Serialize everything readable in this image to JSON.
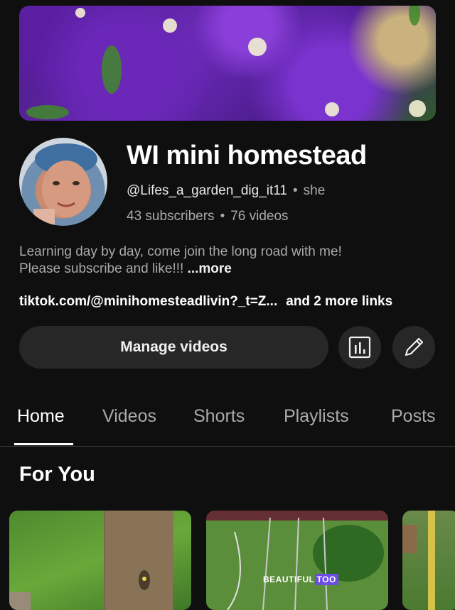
{
  "channel": {
    "title": "WI mini homestead",
    "handle": "@Lifes_a_garden_dig_it11",
    "pronoun": "she",
    "subscribers": "43 subscribers",
    "videos": "76 videos",
    "description_line1": "Learning day by day, come join the long road with me!",
    "description_line2": "Please subscribe and like!!!",
    "more_label": "...more",
    "link": "tiktok.com/@minihomesteadlivin?_t=Z...",
    "more_links": "and 2 more links"
  },
  "actions": {
    "manage_videos": "Manage videos",
    "analytics_icon": "analytics-icon",
    "edit_icon": "pencil-icon"
  },
  "tabs": [
    {
      "label": "Home",
      "active": true
    },
    {
      "label": "Videos",
      "active": false
    },
    {
      "label": "Shorts",
      "active": false
    },
    {
      "label": "Playlists",
      "active": false
    },
    {
      "label": "Posts",
      "active": false
    }
  ],
  "section": {
    "title": "For You"
  },
  "thumbnails": [
    {
      "overlay_text": ""
    },
    {
      "overlay_text_a": "BEAUTIFUL",
      "overlay_text_b": "TOO"
    },
    {
      "overlay_text": ""
    }
  ],
  "colors": {
    "background": "#0f0f0f",
    "surface": "#272727",
    "text_primary": "#f1f1f1",
    "text_secondary": "#aaaaaa"
  }
}
